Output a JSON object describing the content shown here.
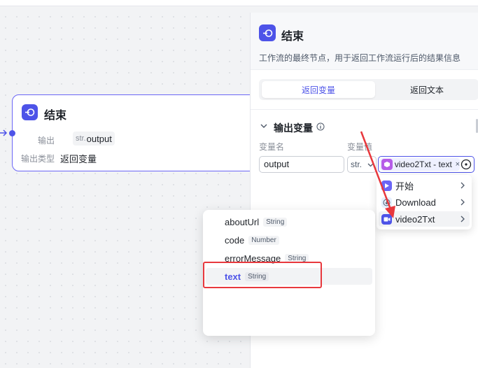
{
  "node": {
    "title": "结束",
    "output_label": "输出",
    "output_type_prefix": "str.",
    "output_value": "output",
    "output_type_label": "输出类型",
    "output_type_value": "返回变量"
  },
  "panel": {
    "title": "结束",
    "description": "工作流的最终节点，用于返回工作流运行后的结果信息",
    "tabs": [
      {
        "label": "返回变量",
        "active": true
      },
      {
        "label": "返回文本",
        "active": false
      }
    ],
    "section_title": "输出变量",
    "col_name": "变量名",
    "col_value": "变量值",
    "var_name_value": "output",
    "var_type": "str.",
    "ref_chip_text": "video2Txt - text",
    "ref_chip_close": "×"
  },
  "cascader": {
    "items": [
      {
        "label": "开始",
        "icon": "start-node-icon",
        "color": "#6b66f6"
      },
      {
        "label": "Download",
        "icon": "download-plugin-icon",
        "color": "#e6f0ff"
      },
      {
        "label": "video2Txt",
        "icon": "video-plugin-icon",
        "color": "#4d53e8"
      }
    ]
  },
  "popup": {
    "fields": [
      {
        "name": "aboutUrl",
        "type": "String"
      },
      {
        "name": "code",
        "type": "Number"
      },
      {
        "name": "errorMessage",
        "type": "String"
      },
      {
        "name": "text",
        "type": "String",
        "selected": true
      }
    ]
  },
  "colors": {
    "accent": "#4d53e8",
    "highlight": "#e8383d"
  }
}
